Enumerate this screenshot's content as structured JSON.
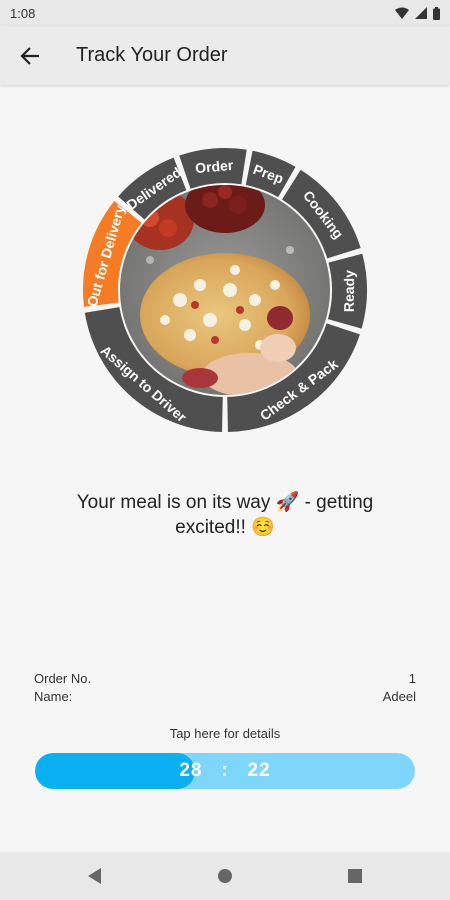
{
  "status_bar": {
    "time": "1:08"
  },
  "app_bar": {
    "title": "Track Your Order"
  },
  "stages": [
    {
      "id": "order",
      "label": "Order",
      "active": false
    },
    {
      "id": "prep",
      "label": "Prep",
      "active": false
    },
    {
      "id": "cooking",
      "label": "Cooking",
      "active": false
    },
    {
      "id": "ready",
      "label": "Ready",
      "active": false
    },
    {
      "id": "check_pack",
      "label": "Check & Pack",
      "active": false
    },
    {
      "id": "assign_driver",
      "label": "Assign to Driver",
      "active": false
    },
    {
      "id": "out_for_delivery",
      "label": "Out for Delivery",
      "active": true
    },
    {
      "id": "delivered",
      "label": "Delivered",
      "active": false
    }
  ],
  "colors": {
    "stage_inactive": "#4f4f4f",
    "stage_active": "#f57c24",
    "progress_fill": "#0ab0f2",
    "progress_track": "#7fd6fb"
  },
  "message": {
    "text": "Your meal is on its way 🚀 - getting excited!! ☺️"
  },
  "order": {
    "number_label": "Order No.",
    "number_value": "1",
    "name_label": "Name:",
    "name_value": "Adeel"
  },
  "details_link": "Tap here for details",
  "timer": {
    "minutes": "28",
    "seconds": "22",
    "separator": ":",
    "progress": 0.42
  },
  "nav": {
    "back": "back-triangle",
    "home": "home-circle",
    "recents": "recents-square"
  }
}
